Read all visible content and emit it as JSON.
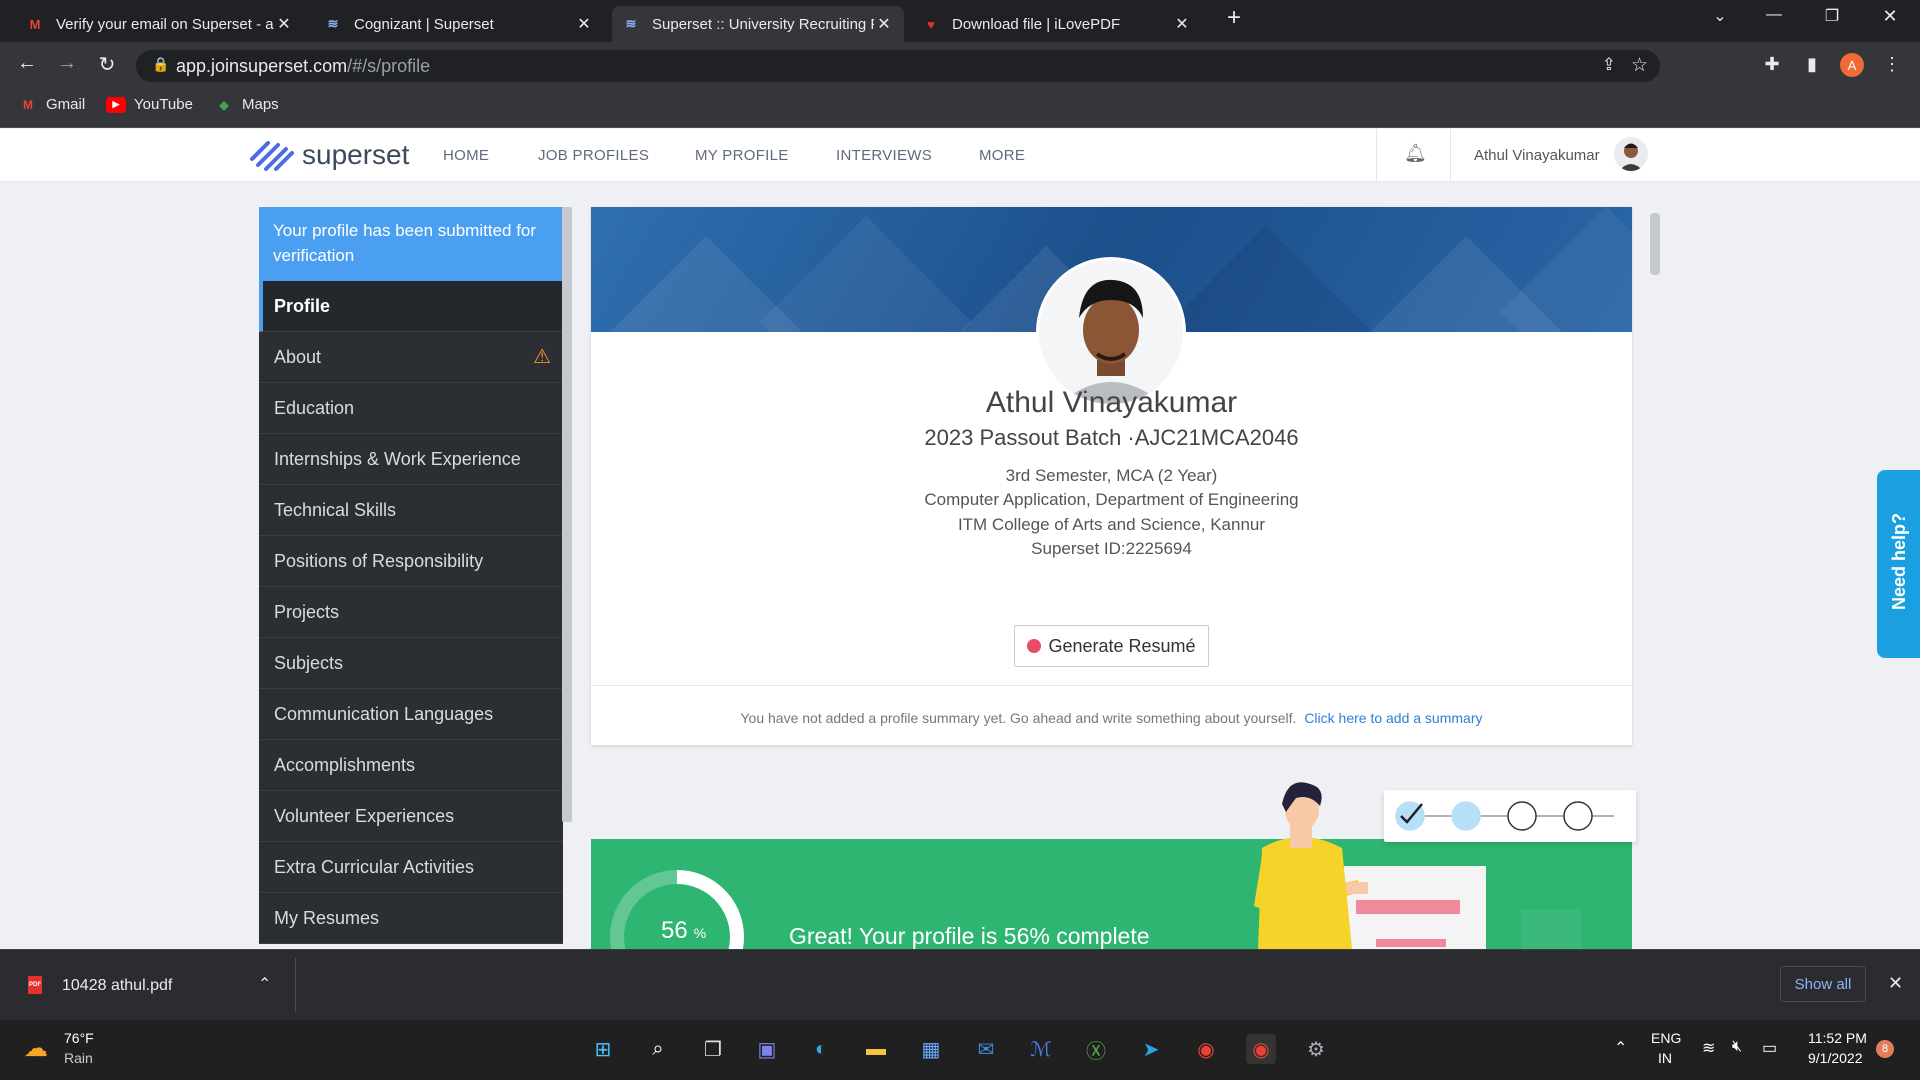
{
  "browser": {
    "tabs": [
      {
        "title": "Verify your email on Superset - a",
        "favicon": "gmail-icon",
        "active": false
      },
      {
        "title": "Cognizant | Superset",
        "favicon": "superset-icon",
        "active": false
      },
      {
        "title": "Superset :: University Recruiting F",
        "favicon": "superset-icon",
        "active": true
      },
      {
        "title": "Download file | iLovePDF",
        "favicon": "ilovepdf-icon",
        "active": false
      }
    ],
    "close_glyph": "✕",
    "new_tab_glyph": "+",
    "url_host": "app.joinsuperset.com",
    "url_path": "/#/s/profile",
    "profile_initial": "A",
    "bookmarks": [
      {
        "label": "Gmail",
        "icon": "gmail-icon"
      },
      {
        "label": "YouTube",
        "icon": "youtube-icon"
      },
      {
        "label": "Maps",
        "icon": "maps-icon"
      }
    ]
  },
  "site": {
    "logo_text": "superset",
    "nav": [
      "HOME",
      "JOB PROFILES",
      "MY PROFILE",
      "INTERVIEWS",
      "MORE"
    ],
    "user_name": "Athul Vinayakumar"
  },
  "sidebar": {
    "notice": "Your profile has been submitted for verification",
    "items": [
      {
        "label": "Profile",
        "active": true,
        "warning": false
      },
      {
        "label": "About",
        "active": false,
        "warning": true
      },
      {
        "label": "Education",
        "active": false,
        "warning": false
      },
      {
        "label": "Internships & Work Experience",
        "active": false,
        "warning": false
      },
      {
        "label": "Technical Skills",
        "active": false,
        "warning": false
      },
      {
        "label": "Positions of Responsibility",
        "active": false,
        "warning": false
      },
      {
        "label": "Projects",
        "active": false,
        "warning": false
      },
      {
        "label": "Subjects",
        "active": false,
        "warning": false
      },
      {
        "label": "Communication Languages",
        "active": false,
        "warning": false
      },
      {
        "label": "Accomplishments",
        "active": false,
        "warning": false
      },
      {
        "label": "Volunteer Experiences",
        "active": false,
        "warning": false
      },
      {
        "label": "Extra Curricular Activities",
        "active": false,
        "warning": false
      },
      {
        "label": "My Resumes",
        "active": false,
        "warning": false
      }
    ]
  },
  "profile": {
    "name": "Athul Vinayakumar",
    "batch": "2023 Passout Batch ·AJC21MCA2046",
    "semester": "3rd Semester, MCA (2 Year)",
    "department": "Computer Application, Department of Engineering",
    "college": "ITM College of Arts and Science, Kannur",
    "superset_id": "Superset ID:2225694",
    "generate_button": "Generate Resumé",
    "summary_prompt": "You have not added a profile summary yet. Go ahead and write something about yourself.",
    "summary_link": "Click here to add a summary"
  },
  "progress": {
    "percent": 56,
    "percent_label": "56",
    "percent_sign": "%",
    "message": "Great! Your profile is 56% complete",
    "steps_done": 1,
    "steps_total": 4
  },
  "help_tab": "Need help?",
  "download": {
    "file": "10428 athul.pdf",
    "show_all": "Show all"
  },
  "taskbar": {
    "weather_temp": "76°F",
    "weather_desc": "Rain",
    "lang1": "ENG",
    "lang2": "IN",
    "time": "11:52 PM",
    "date": "9/1/2022",
    "notif_count": "8"
  },
  "colors": {
    "accent_blue": "#4b9ff0",
    "sidebar_bg": "#2b2f33",
    "progress_green": "#2fb572",
    "link_blue": "#2d7fd6",
    "warning": "#f0912b"
  }
}
